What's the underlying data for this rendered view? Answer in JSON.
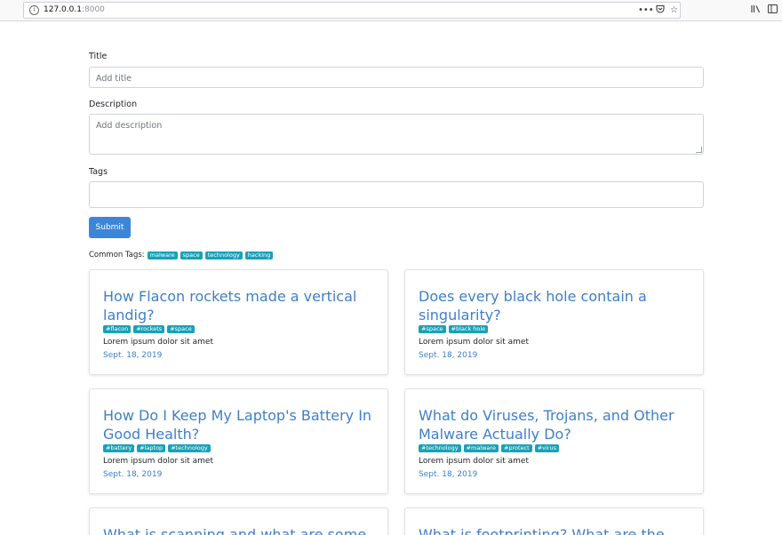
{
  "browser": {
    "url_host": "127.0.0.1",
    "url_port": ":8000",
    "icons": [
      "info-icon",
      "more-icon",
      "pocket-icon",
      "bookmark-star-icon",
      "library-icon",
      "sidebar-icon"
    ]
  },
  "form": {
    "title_label": "Title",
    "title_placeholder": "Add title",
    "description_label": "Description",
    "description_placeholder": "Add description",
    "tags_label": "Tags",
    "tags_value": "",
    "submit_label": "Submit"
  },
  "common_tags": {
    "label": "Common Tags:",
    "tags": [
      "malware",
      "space",
      "technology",
      "hacking"
    ]
  },
  "colors": {
    "primary": "#3c86d9",
    "link": "#3f7fc9",
    "badge": "#17a2b8"
  },
  "posts": [
    {
      "title": "How Flacon rockets made a vertical landig?",
      "tags": [
        "#flacon",
        "#rockets",
        "#space"
      ],
      "description": "Lorem ipsum dolor sit amet",
      "date": "Sept. 18, 2019"
    },
    {
      "title": "Does every black hole contain a singularity?",
      "tags": [
        "#space",
        "#black hole"
      ],
      "description": "Lorem ipsum dolor sit amet",
      "date": "Sept. 18, 2019"
    },
    {
      "title": "How Do I Keep My Laptop's Battery In Good Health?",
      "tags": [
        "#battery",
        "#laptop",
        "#technology"
      ],
      "description": "Lorem ipsum dolor sit amet",
      "date": "Sept. 18, 2019"
    },
    {
      "title": "What do Viruses, Trojans, and Other Malware Actually Do?",
      "tags": [
        "#technology",
        "#malware",
        "#protect",
        "#virus"
      ],
      "description": "Lorem ipsum dolor sit amet",
      "date": "Sept. 18, 2019"
    },
    {
      "title": "What is scanning and what are some",
      "tags": [],
      "description": "",
      "date": ""
    },
    {
      "title": "What is footprinting? What are the",
      "tags": [],
      "description": "",
      "date": ""
    }
  ]
}
